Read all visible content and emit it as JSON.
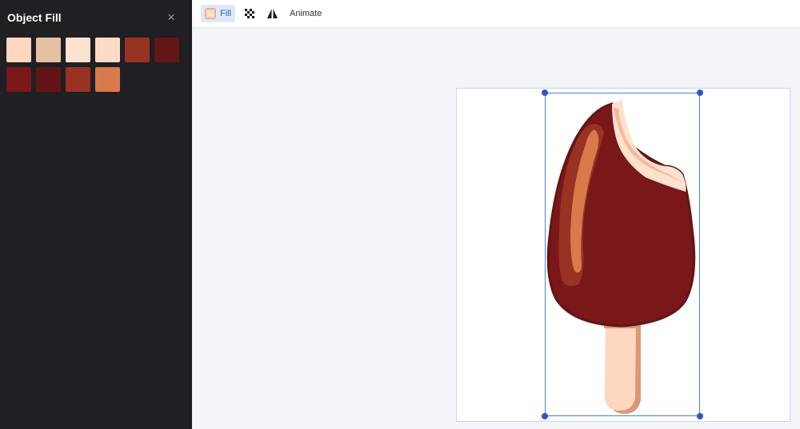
{
  "panel": {
    "title": "Object Fill",
    "close_glyph": "×",
    "close_icon": "close-icon",
    "swatches": [
      "#fdd7c0",
      "#e4c1a1",
      "#fde2cf",
      "#fddac5",
      "#983222",
      "#621615",
      "#7a1719",
      "#631414",
      "#983222",
      "#d87a4c"
    ]
  },
  "toolbar": {
    "fill_label": "Fill",
    "fill_icon": "fill-icon",
    "transparency_icon": "checkerboard-icon",
    "flip_icon": "flip-icon",
    "animate_label": "Animate"
  },
  "canvas": {
    "object": "popsicle-illustration",
    "colors": {
      "coating": "#7a1719",
      "outline": "#621615",
      "highlight": "#983222",
      "shine": "#d87a4c",
      "stick": "#fdd7c0",
      "stick_shadow": "#d99a73",
      "bite": "#fde2cf"
    }
  }
}
